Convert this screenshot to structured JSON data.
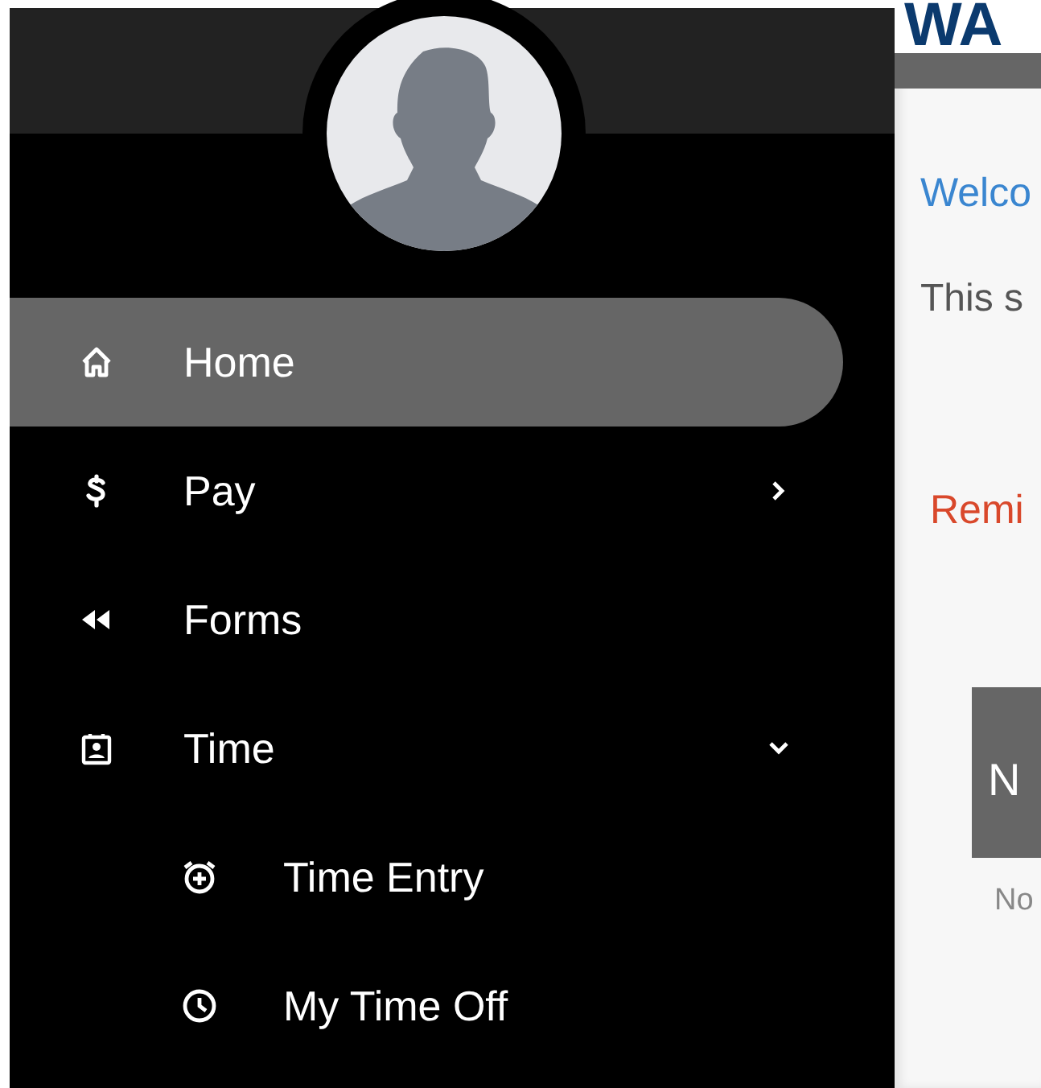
{
  "sidebar": {
    "items": [
      {
        "label": "Home",
        "selected": true
      },
      {
        "label": "Pay",
        "selected": false,
        "expanded": false
      },
      {
        "label": "Forms",
        "selected": false
      },
      {
        "label": "Time",
        "selected": false,
        "expanded": true,
        "children": [
          {
            "label": "Time Entry",
            "selected": false
          },
          {
            "label": "My Time Off",
            "selected": false
          }
        ]
      }
    ]
  },
  "content": {
    "header_title": "WA",
    "welcome": "Welco",
    "intro": "This s",
    "reminder": "Remi",
    "tile_letter": "N",
    "tile_caption": "No"
  }
}
